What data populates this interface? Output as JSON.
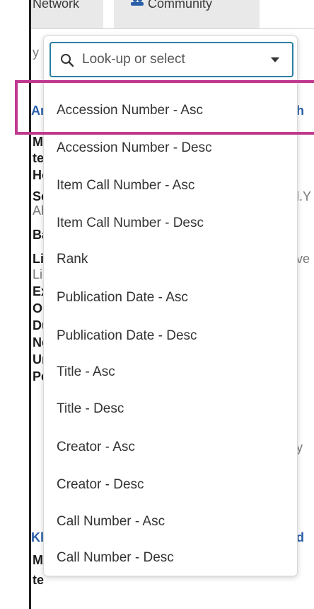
{
  "tabs": [
    {
      "label": "Network"
    },
    {
      "label": "Community"
    }
  ],
  "background_fragments": [
    {
      "text": "y :",
      "kind": "muted"
    },
    {
      "text": "Ar",
      "kind": "link"
    },
    {
      "text": "h",
      "kind": "link"
    },
    {
      "text": "MI",
      "kind": "bold"
    },
    {
      "text": "te",
      "kind": "bold"
    },
    {
      "text": "Ho",
      "kind": "bold"
    },
    {
      "text": "So",
      "kind": "bold"
    },
    {
      "text": "l.Y",
      "kind": "muted"
    },
    {
      "text": "Ab",
      "kind": "muted"
    },
    {
      "text": "Ba",
      "kind": "bold"
    },
    {
      "text": "Lib",
      "kind": "bold"
    },
    {
      "text": "ve",
      "kind": "muted"
    },
    {
      "text": "Lib",
      "kind": "muted"
    },
    {
      "text": "Ex",
      "kind": "bold"
    },
    {
      "text": "On",
      "kind": "bold"
    },
    {
      "text": "Du",
      "kind": "bold"
    },
    {
      "text": "Ne",
      "kind": "bold"
    },
    {
      "text": "Un",
      "kind": "bold"
    },
    {
      "text": "Pe",
      "kind": "bold"
    },
    {
      "text": "y",
      "kind": "muted"
    },
    {
      "text": "Kl",
      "kind": "link"
    },
    {
      "text": "d",
      "kind": "link"
    },
    {
      "text": "MI",
      "kind": "bold"
    },
    {
      "text": "te",
      "kind": "bold"
    }
  ],
  "sort_select": {
    "placeholder": "Look-up or select",
    "search_icon": "search-icon",
    "caret_icon": "caret-down-icon",
    "accent_color": "#2b7fa3"
  },
  "sort_options": [
    {
      "label": "Accession Number - Asc",
      "highlighted": true
    },
    {
      "label": "Accession Number - Desc"
    },
    {
      "label": "Item Call Number - Asc"
    },
    {
      "label": "Item Call Number - Desc"
    },
    {
      "label": "Rank"
    },
    {
      "label": "Publication Date - Asc"
    },
    {
      "label": "Publication Date - Desc"
    },
    {
      "label": "Title - Asc"
    },
    {
      "label": "Title - Desc"
    },
    {
      "label": "Creator - Asc"
    },
    {
      "label": "Creator - Desc"
    },
    {
      "label": "Call Number - Asc"
    },
    {
      "label": "Call Number - Desc"
    }
  ],
  "highlight_color": "#c0398f"
}
